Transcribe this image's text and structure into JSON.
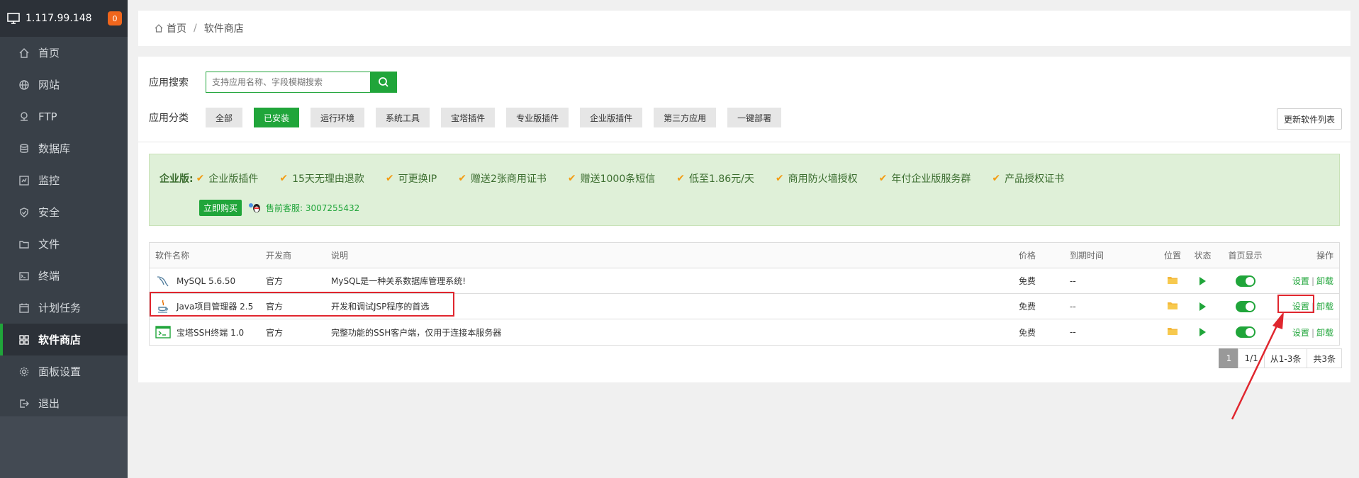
{
  "header": {
    "ip": "1.117.99.148",
    "badge": "0"
  },
  "sidebar": {
    "items": [
      {
        "label": "首页",
        "icon": "home-icon"
      },
      {
        "label": "网站",
        "icon": "globe-icon"
      },
      {
        "label": "FTP",
        "icon": "ftp-icon"
      },
      {
        "label": "数据库",
        "icon": "database-icon"
      },
      {
        "label": "监控",
        "icon": "monitor-icon"
      },
      {
        "label": "安全",
        "icon": "shield-icon"
      },
      {
        "label": "文件",
        "icon": "folder-icon"
      },
      {
        "label": "终端",
        "icon": "terminal-icon"
      },
      {
        "label": "计划任务",
        "icon": "clock-icon"
      },
      {
        "label": "软件商店",
        "icon": "grid-icon"
      },
      {
        "label": "面板设置",
        "icon": "gear-icon"
      },
      {
        "label": "退出",
        "icon": "logout-icon"
      }
    ],
    "active_index": 9
  },
  "breadcrumb": {
    "home": "首页",
    "separator": "/",
    "current": "软件商店"
  },
  "search": {
    "label": "应用搜索",
    "placeholder": "支持应用名称、字段模糊搜索"
  },
  "categories": {
    "label": "应用分类",
    "items": [
      "全部",
      "已安装",
      "运行环境",
      "系统工具",
      "宝塔插件",
      "专业版插件",
      "企业版插件",
      "第三方应用",
      "一键部署"
    ],
    "active": "已安装"
  },
  "refresh_button": "更新软件列表",
  "enterprise": {
    "title": "企业版:",
    "features": [
      "企业版插件",
      "15天无理由退款",
      "可更换IP",
      "赠送2张商用证书",
      "赠送1000条短信",
      "低至1.86元/天",
      "商用防火墙授权",
      "年付企业版服务群",
      "产品授权证书"
    ],
    "buy_button": "立即购买",
    "service": "售前客服: 3007255432"
  },
  "table": {
    "headers": {
      "name": "软件名称",
      "developer": "开发商",
      "description": "说明",
      "price": "价格",
      "expire": "到期时间",
      "location": "位置",
      "status": "状态",
      "home_display": "首页显示",
      "ops": "操作"
    },
    "rows": [
      {
        "name": "MySQL 5.6.50",
        "developer": "官方",
        "description": "MySQL是一种关系数据库管理系统!",
        "price": "免费",
        "expire": "--",
        "settings": "设置",
        "uninstall": "卸载",
        "icon": "mysql-dolphin-icon"
      },
      {
        "name": "Java项目管理器 2.5",
        "developer": "官方",
        "description": "开发和调试JSP程序的首选",
        "price": "免费",
        "expire": "--",
        "settings": "设置",
        "uninstall": "卸载",
        "icon": "java-cup-icon"
      },
      {
        "name": "宝塔SSH终端 1.0",
        "developer": "官方",
        "description": "完整功能的SSH客户端，仅用于连接本服务器",
        "price": "免费",
        "expire": "--",
        "settings": "设置",
        "uninstall": "卸载",
        "icon": "terminal-icon"
      }
    ],
    "op_separator": "|"
  },
  "pager": {
    "current": "1",
    "pages": "1/1",
    "range": "从1-3条",
    "total": "共3条"
  },
  "colors": {
    "accent": "#20a53a",
    "sidebar": "#394048",
    "highlight": "#e0262e",
    "check": "#f39c12"
  }
}
